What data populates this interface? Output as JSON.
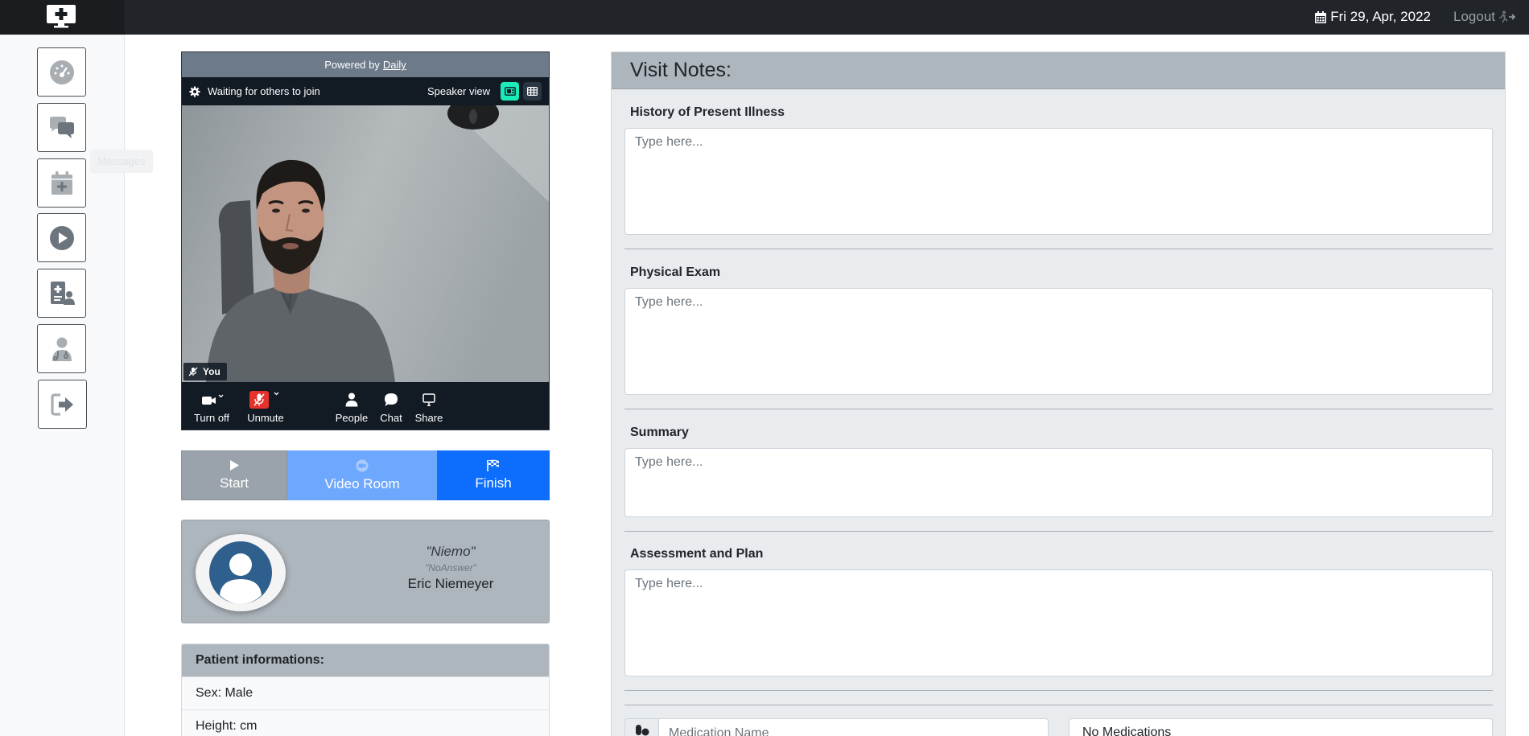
{
  "navbar": {
    "date": "Fri 29, Apr, 2022",
    "logout_label": "Logout"
  },
  "sidebar": {
    "items": [
      {
        "name": "dashboard",
        "icon": "gauge-icon"
      },
      {
        "name": "messages",
        "icon": "chat-bubbles-icon"
      },
      {
        "name": "appointments",
        "icon": "calendar-plus-icon"
      },
      {
        "name": "visits",
        "icon": "play-circle-icon"
      },
      {
        "name": "patients",
        "icon": "patient-file-icon"
      },
      {
        "name": "doctor",
        "icon": "doctor-icon"
      },
      {
        "name": "logout",
        "icon": "sign-out-icon"
      }
    ],
    "tooltip": "Messages"
  },
  "video": {
    "powered_by": "Powered by",
    "powered_link": "Daily",
    "waiting": "Waiting for others to join",
    "speaker_view": "Speaker view",
    "self_label": "You",
    "controls": {
      "camera": "Turn off",
      "mic": "Unmute",
      "people": "People",
      "chat": "Chat",
      "share": "Share"
    }
  },
  "session": {
    "start": "Start",
    "video_room": "Video Room",
    "finish": "Finish"
  },
  "patient": {
    "nickname": "\"Niemo\"",
    "answer": "\"NoAnswer\"",
    "full_name": "Eric Niemeyer"
  },
  "patient_info": {
    "title": "Patient informations:",
    "sex": "Sex: Male",
    "height": "Height: cm"
  },
  "visit_notes": {
    "title": "Visit Notes:",
    "placeholder": "Type here...",
    "sections": {
      "hpi": "History of Present Illness",
      "exam": "Physical Exam",
      "summary": "Summary",
      "plan": "Assessment and Plan"
    },
    "medication_placeholder": "Medication Name",
    "no_medications": "No Medications"
  },
  "colors": {
    "navbar": "#212529",
    "primary": "#0d6efd",
    "primary_light": "#6ea8fe",
    "secondary": "#adb5bd",
    "daily_accent": "#1bebb9",
    "mute_red": "#e6322d"
  }
}
